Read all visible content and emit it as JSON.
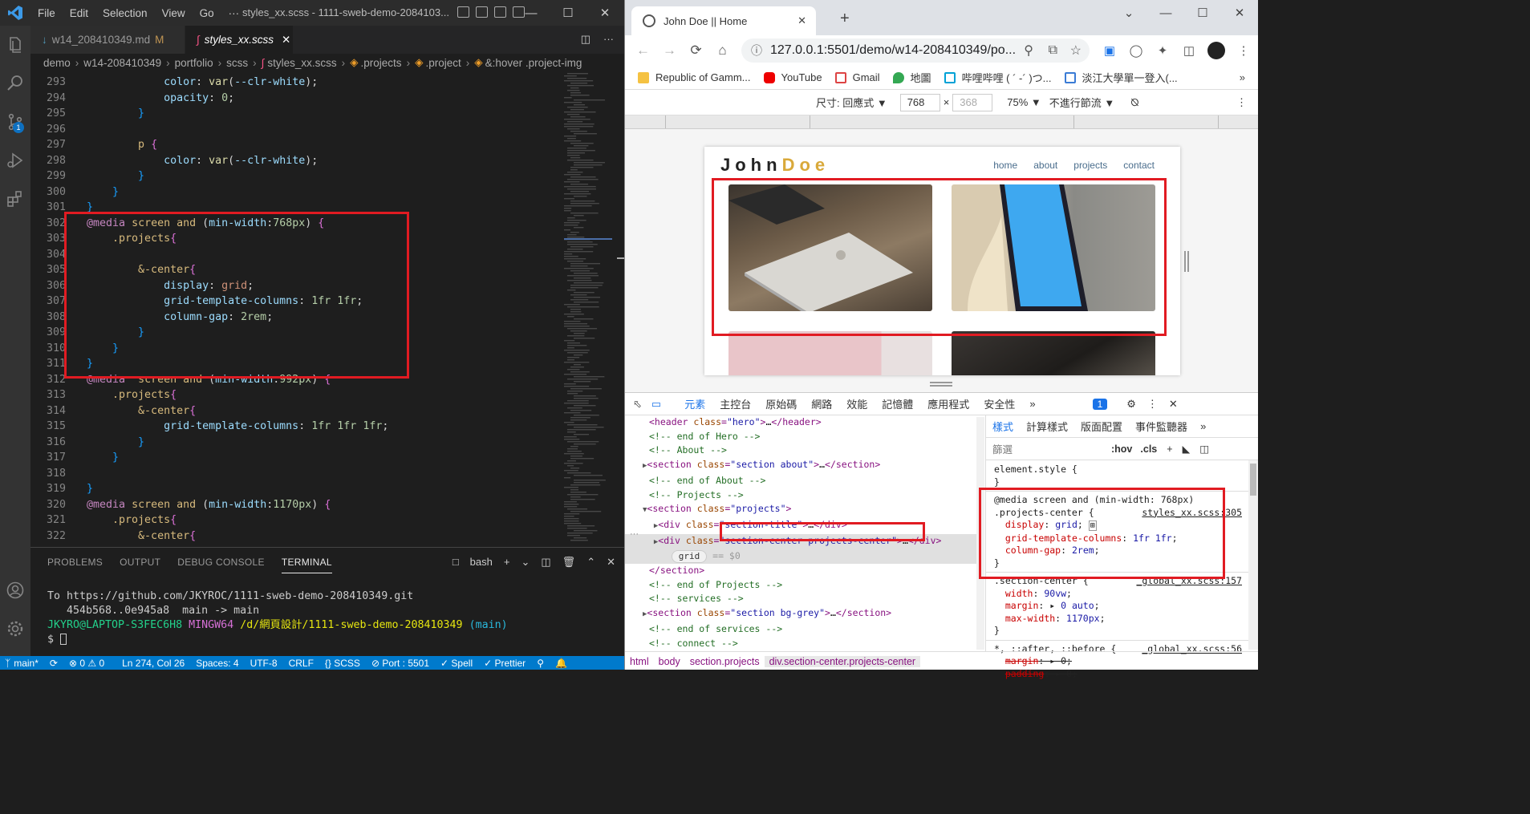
{
  "vscode": {
    "menu": [
      "File",
      "Edit",
      "Selection",
      "View",
      "Go",
      "···"
    ],
    "window_title": "styles_xx.scss - 1111-sweb-demo-2084103...",
    "tabs": [
      {
        "label": "w14_208410349.md",
        "modified": "M"
      },
      {
        "label": "styles_xx.scss"
      }
    ],
    "breadcrumb": [
      "demo",
      "w14-208410349",
      "portfolio",
      "scss",
      "styles_xx.scss",
      ".projects",
      ".project",
      "&:hover .project-img"
    ],
    "activity_badge": "1",
    "code_lines": [
      {
        "n": "293",
        "t": "            color: var(--clr-white);"
      },
      {
        "n": "294",
        "t": "            opacity: 0;"
      },
      {
        "n": "295",
        "t": "        }"
      },
      {
        "n": "296",
        "t": ""
      },
      {
        "n": "297",
        "t": "        p {"
      },
      {
        "n": "298",
        "t": "            color: var(--clr-white);"
      },
      {
        "n": "299",
        "t": "        }"
      },
      {
        "n": "300",
        "t": "    }"
      },
      {
        "n": "301",
        "t": "}"
      },
      {
        "n": "302",
        "t": "@media screen and (min-width:768px) {"
      },
      {
        "n": "303",
        "t": "    .projects{"
      },
      {
        "n": "304",
        "t": ""
      },
      {
        "n": "305",
        "t": "        &-center{"
      },
      {
        "n": "306",
        "t": "            display: grid;"
      },
      {
        "n": "307",
        "t": "            grid-template-columns: 1fr 1fr;"
      },
      {
        "n": "308",
        "t": "            column-gap: 2rem;"
      },
      {
        "n": "309",
        "t": "        }"
      },
      {
        "n": "310",
        "t": "    }"
      },
      {
        "n": "311",
        "t": "}"
      },
      {
        "n": "312",
        "t": "@media  screen and (min-width:992px) {"
      },
      {
        "n": "313",
        "t": "    .projects{"
      },
      {
        "n": "314",
        "t": "        &-center{"
      },
      {
        "n": "315",
        "t": "            grid-template-columns: 1fr 1fr 1fr;"
      },
      {
        "n": "316",
        "t": "        }"
      },
      {
        "n": "317",
        "t": "    }"
      },
      {
        "n": "318",
        "t": ""
      },
      {
        "n": "319",
        "t": "}"
      },
      {
        "n": "320",
        "t": "@media screen and (min-width:1170px) {"
      },
      {
        "n": "321",
        "t": "    .projects{"
      },
      {
        "n": "322",
        "t": "        &-center{"
      }
    ],
    "panel_tabs": [
      "PROBLEMS",
      "OUTPUT",
      "DEBUG CONSOLE",
      "TERMINAL"
    ],
    "terminal_shell": "bash",
    "terminal_lines": [
      "To https://github.com/JKYROC/1111-sweb-demo-208410349.git",
      "   454b568..0e945a8  main -> main",
      ""
    ],
    "prompt_user": "JKYRO@LAPTOP-S3FEC6H8",
    "prompt_env": "MINGW64",
    "prompt_path": "/d/網頁設計/1111-sweb-demo-208410349",
    "prompt_branch": "(main)",
    "prompt_symbol": "$",
    "status": {
      "branch": "main*",
      "errors": "⊗ 0 ⚠ 0",
      "position": "Ln 274, Col 26",
      "spaces": "Spaces: 4",
      "encoding": "UTF-8",
      "eol": "CRLF",
      "lang": "{} SCSS",
      "port": "⊘ Port : 5501",
      "spell": "✓ Spell",
      "prettier": "✓ Prettier"
    }
  },
  "chrome": {
    "tab_title": "John Doe || Home",
    "url": "127.0.0.1:5501/demo/w14-208410349/po...",
    "bookmarks": [
      "Republic of Gamm...",
      "YouTube",
      "Gmail",
      "地圖",
      "哔哩哔哩 ( ´ -´ )つ...",
      "淡江大學單一登入(..."
    ],
    "device_toolbar": {
      "size_label": "尺寸: 回應式 ▼",
      "width": "768",
      "x": "×",
      "height": "368",
      "zoom": "75% ▼",
      "throttle": "不進行節流 ▼"
    },
    "page": {
      "logo_a": "John",
      "logo_b": "Doe",
      "nav": [
        "home",
        "about",
        "projects",
        "contact"
      ]
    },
    "devtools_tabs": [
      "元素",
      "主控台",
      "原始碼",
      "網路",
      "效能",
      "記憶體",
      "應用程式",
      "安全性"
    ],
    "devtools_issue_count": "1",
    "styles_tabs": [
      "樣式",
      "計算樣式",
      "版面配置",
      "事件監聽器"
    ],
    "filter_placeholder": "篩選",
    "filter_hov": ":hov",
    "filter_cls": ".cls",
    "crumbs": [
      "html",
      "body",
      "section.projects",
      "div.section-center.projects-center"
    ]
  }
}
